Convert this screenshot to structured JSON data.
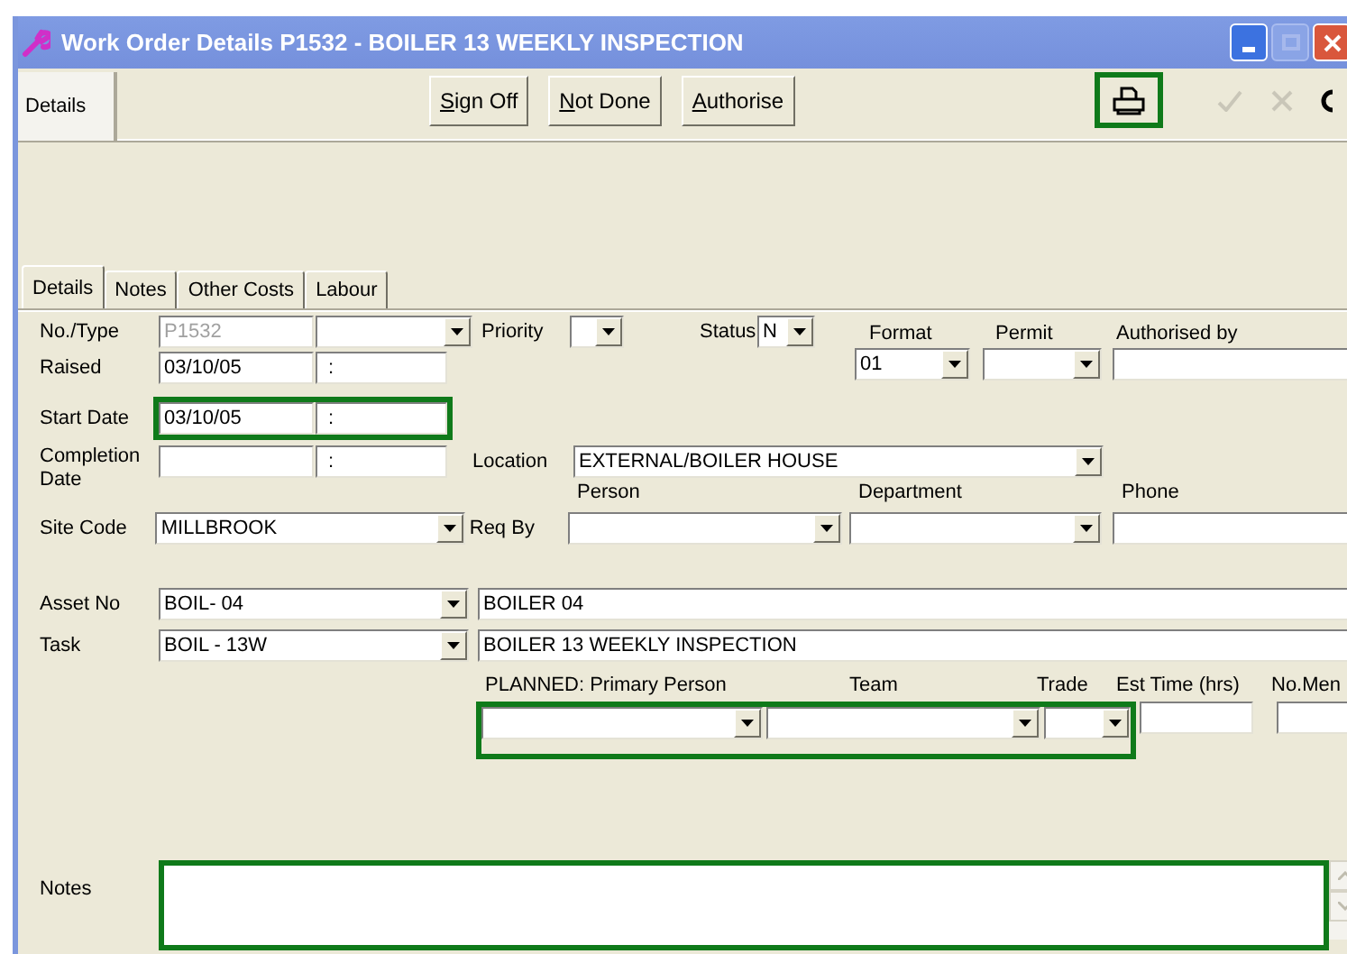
{
  "window": {
    "title": "Work Order Details P1532 - BOILER 13 WEEKLY INSPECTION"
  },
  "top_tabs": [
    {
      "label": "Details",
      "selected": true
    }
  ],
  "toolbar": {
    "buttons": [
      {
        "label": "Sign Off"
      },
      {
        "label": "Not Done"
      },
      {
        "label": "Authorise"
      }
    ],
    "print": {
      "highlighted": true
    },
    "confirm": {
      "disabled": true
    },
    "cancel": {
      "disabled": true
    }
  },
  "tabs": [
    {
      "label": "Details",
      "selected": true
    },
    {
      "label": "Notes",
      "selected": false
    },
    {
      "label": "Other Costs",
      "selected": false
    },
    {
      "label": "Labour",
      "selected": false
    }
  ],
  "form": {
    "no_type": {
      "label": "No./Type",
      "value": "P1532",
      "disabled": true
    },
    "priority": {
      "label": "Priority"
    },
    "status": {
      "label": "Status",
      "value": "N"
    },
    "format": {
      "label": "Format",
      "value": "01"
    },
    "permit": {
      "label": "Permit"
    },
    "authorised_by": {
      "label": "Authorised by"
    },
    "raised": {
      "label": "Raised",
      "date": "03/10/05",
      "time": ":"
    },
    "start_date": {
      "label": "Start Date",
      "date": "03/10/05",
      "time": ":",
      "highlighted": true
    },
    "completion_date": {
      "label": "Completion Date",
      "time": ":"
    },
    "location": {
      "label": "Location",
      "value": "EXTERNAL/BOILER HOUSE"
    },
    "req_by": {
      "label": "Req By",
      "person_label": "Person",
      "department_label": "Department",
      "phone_label": "Phone"
    },
    "site_code": {
      "label": "Site Code",
      "value": "MILLBROOK"
    },
    "asset": {
      "label": "Asset No",
      "code": "BOIL- 04",
      "description": "BOILER 04"
    },
    "task": {
      "label": "Task",
      "code": "BOIL - 13W",
      "description": "BOILER 13 WEEKLY INSPECTION"
    },
    "planned": {
      "primary_person_label": "PLANNED: Primary Person",
      "team_label": "Team",
      "trade_label": "Trade",
      "highlighted": true
    },
    "est_time": {
      "label": "Est Time (hrs)"
    },
    "no_men": {
      "label": "No.Men"
    },
    "notes": {
      "label": "Notes",
      "highlighted": true
    }
  }
}
